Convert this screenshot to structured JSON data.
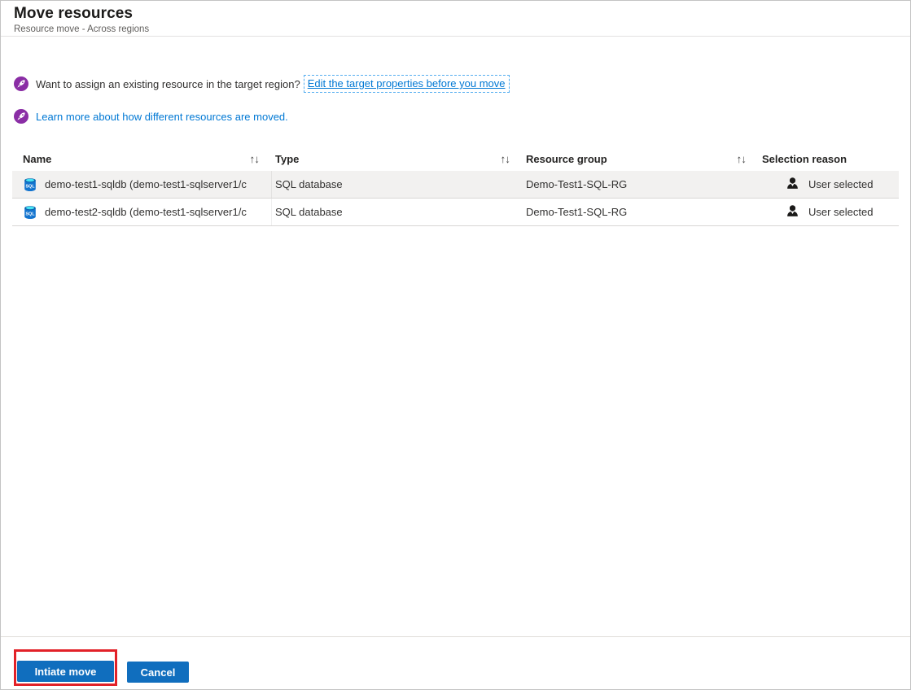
{
  "header": {
    "title": "Move resources",
    "subtitle": "Resource move - Across regions"
  },
  "notices": [
    {
      "icon": "resource-mover-rocket",
      "text": "Want to assign an existing resource in the target region?",
      "link": "Edit the target properties before you move",
      "link_focus_outline": true
    },
    {
      "icon": "resource-mover-rocket",
      "text": "",
      "link": "Learn more about how different resources are moved.",
      "link_focus_outline": false
    }
  ],
  "table": {
    "sort_icon": "↑↓",
    "columns": [
      {
        "label": "Name",
        "sortable": true
      },
      {
        "label": "Type",
        "sortable": true
      },
      {
        "label": "Resource group",
        "sortable": true
      },
      {
        "label": "Selection reason",
        "sortable": false
      }
    ],
    "rows": [
      {
        "icon": "sql-database-icon",
        "name": "demo-test1-sqldb (demo-test1-sqlserver1/c",
        "type": "SQL database",
        "resource_group": "Demo-Test1-SQL-RG",
        "selection_reason_icon": "person-icon",
        "selection_reason": "User selected",
        "highlighted": true
      },
      {
        "icon": "sql-database-icon",
        "name": "demo-test2-sqldb (demo-test1-sqlserver1/c",
        "type": "SQL database",
        "resource_group": "Demo-Test1-SQL-RG",
        "selection_reason_icon": "person-icon",
        "selection_reason": "User selected",
        "highlighted": false
      }
    ]
  },
  "footer": {
    "primary_button": "Intiate move",
    "secondary_button": "Cancel",
    "annotation": "red-highlight-box-around-primary-button"
  },
  "colors": {
    "accent_link_blue": "#0078d4",
    "button_blue": "#106ebe",
    "resource_mover_purple": "#8a2da5",
    "annotation_red": "#e22128",
    "row_highlight_gray": "#f2f1f0",
    "sql_icon_blue": "#1374cf",
    "sql_icon_top_cyan": "#45e2f4"
  }
}
